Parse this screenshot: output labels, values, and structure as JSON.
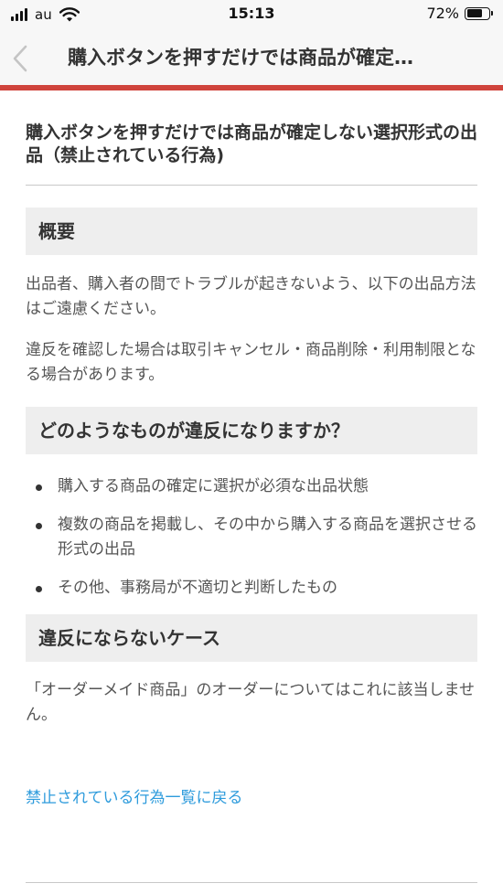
{
  "status_bar": {
    "carrier": "au",
    "time": "15:13",
    "battery_percent": "72%",
    "battery_level": 0.72
  },
  "nav": {
    "title": "購入ボタンを押すだけでは商品が確定…"
  },
  "page": {
    "title": "購入ボタンを押すだけでは商品が確定しない選択形式の出品（禁止されている行為)"
  },
  "sections": {
    "overview": {
      "heading": "概要",
      "p1": "出品者、購入者の間でトラブルが起きないよう、以下の出品方法はご遠慮ください。",
      "p2": "違反を確認した場合は取引キャンセル・商品削除・利用制限となる場合があります。"
    },
    "violations": {
      "heading": "どのようなものが違反になりますか？",
      "items": [
        "購入する商品の確定に選択が必須な出品状態",
        "複数の商品を掲載し、その中から購入する商品を選択させる形式の出品",
        "その他、事務局が不適切と判断したもの"
      ]
    },
    "exceptions": {
      "heading": "違反にならないケース",
      "p1": "「オーダーメイド商品」のオーダーについてはこれに該当しません。"
    }
  },
  "links": {
    "back": "禁止されている行為一覧に戻る"
  }
}
